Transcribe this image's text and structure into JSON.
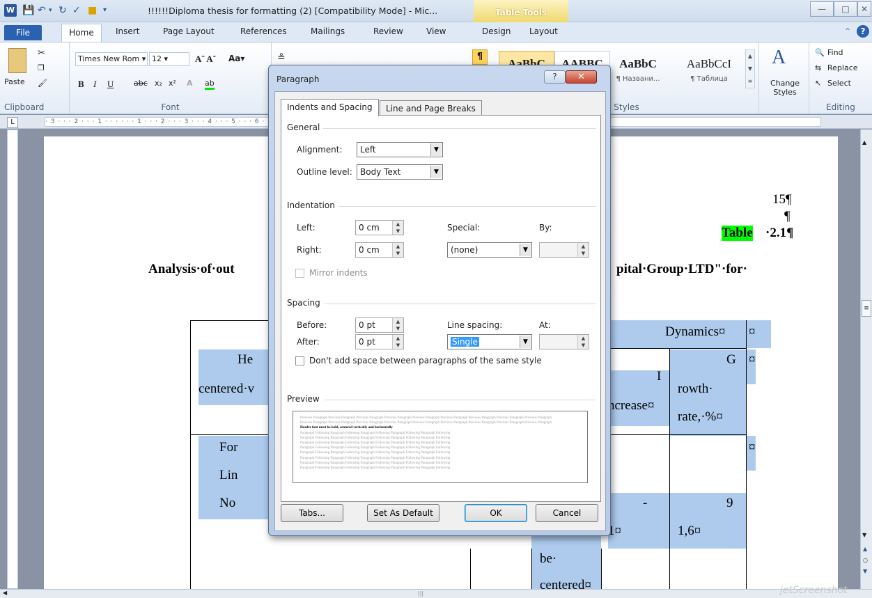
{
  "window": {
    "title": "!!!!!!Diploma thesis for formatting (2) [Compatibility Mode] - Mic...",
    "context_tab": "Table Tools",
    "controls": [
      "—",
      "□",
      "✕"
    ]
  },
  "ribbon_tabs": [
    "File",
    "Home",
    "Insert",
    "Page Layout",
    "References",
    "Mailings",
    "Review",
    "View",
    "Design",
    "Layout"
  ],
  "ribbon": {
    "clipboard": {
      "paste": "Paste",
      "label": "Clipboard"
    },
    "font": {
      "name": "Times New Rom",
      "size": "12",
      "label": "Font"
    },
    "styles": {
      "items": [
        {
          "sample": "AaBbC",
          "name": ""
        },
        {
          "sample": "AABBC",
          "name": ""
        },
        {
          "sample": "AaBbC",
          "name": "¶ Названи..."
        },
        {
          "sample": "AaBbCcI",
          "name": "¶ Таблица"
        }
      ],
      "change_styles": "Change Styles",
      "label": "Styles"
    },
    "editing": {
      "find": "Find",
      "replace": "Replace",
      "select": "Select",
      "label": "Editing"
    }
  },
  "document": {
    "page_number": "15¶",
    "pilcrow": "¶",
    "table_caption_word": "Table",
    "table_caption_number": "·2.1¶",
    "heading_left": "Analysis·of·out",
    "heading_right": "pital·Group·LTD\"·for·",
    "cells": {
      "dynamics": "Dynamics¤",
      "g": "G",
      "i": "I",
      "growth": "rowth·",
      "rate": "rate,·%¤",
      "increase": "ncrease¤",
      "head_partial": "He",
      "centered_partial": "centered·v",
      "for_partial": "For",
      "lin_partial": "Lin",
      "no_partial": "No",
      "dash": "-",
      "nine": "9",
      "one": "1¤",
      "onesix": "1,6¤",
      "be": "be·",
      "centered": "centered¤",
      "currency": "¤"
    }
  },
  "dialog": {
    "title": "Paragraph",
    "help": "?",
    "tabs": [
      "Indents and Spacing",
      "Line and Page Breaks"
    ],
    "general": {
      "section": "General",
      "alignment_label": "Alignment:",
      "alignment_value": "Left",
      "outline_label": "Outline level:",
      "outline_value": "Body Text"
    },
    "indentation": {
      "section": "Indentation",
      "left_label": "Left:",
      "left_value": "0 cm",
      "right_label": "Right:",
      "right_value": "0 cm",
      "special_label": "Special:",
      "special_value": "(none)",
      "by_label": "By:",
      "mirror_label": "Mirror indents"
    },
    "spacing": {
      "section": "Spacing",
      "before_label": "Before:",
      "before_value": "0 pt",
      "after_label": "After:",
      "after_value": "0 pt",
      "line_label": "Line spacing:",
      "line_value": "Single",
      "at_label": "At:",
      "dont_add_label": "Don't add space between paragraphs of the same style"
    },
    "preview": {
      "section": "Preview",
      "previous": "Previous Paragraph Previous Paragraph Previous Paragraph Previous Paragraph Previous Paragraph Previous Paragraph Previous Paragraph Previous Paragraph Previous Paragraph",
      "current": "Header font must be bold, centered vertically and horizontally",
      "following": "Paragraph Following Paragraph Following Paragraph Following Paragraph Following Paragraph Following"
    },
    "buttons": {
      "tabs": "Tabs...",
      "default": "Set As Default",
      "ok": "OK",
      "cancel": "Cancel"
    }
  }
}
